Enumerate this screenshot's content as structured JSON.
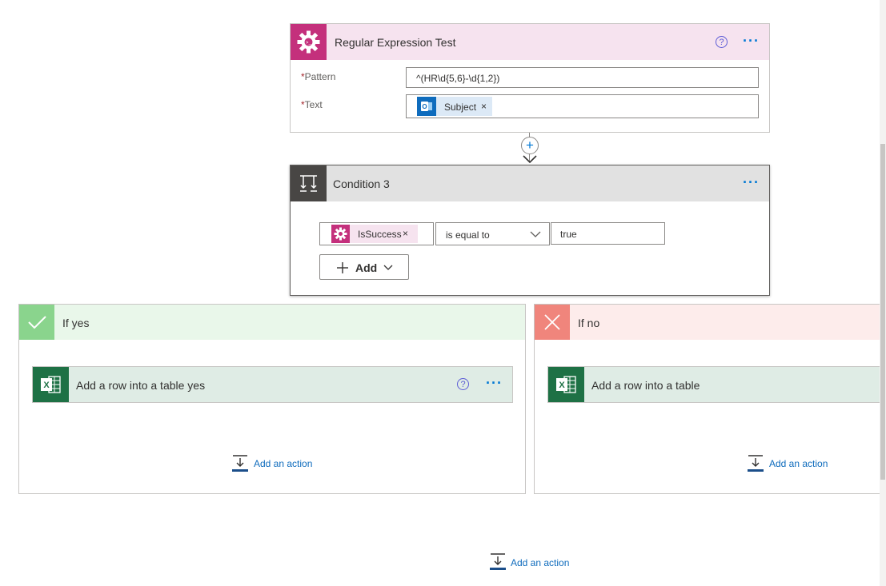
{
  "regex_card": {
    "title": "Regular Expression Test",
    "pattern_label": "Pattern",
    "pattern_value": "^(HR\\d{5,6}-\\d{1,2})",
    "text_label": "Text",
    "text_token": "Subject",
    "required_mark": "*",
    "help_glyph": "?",
    "more_glyph": "···",
    "header_color": "#f6e3ef",
    "icon_color": "#c4307c"
  },
  "connector": {
    "plus_glyph": "+"
  },
  "condition": {
    "title": "Condition 3",
    "more_glyph": "···",
    "left_token": "IsSuccess",
    "operator": "is equal to",
    "right_value": "true",
    "add_label": "Add",
    "header_color": "#e1e1e1",
    "icon_color": "#484644"
  },
  "branch_yes": {
    "title": "If yes",
    "action_title": "Add a row into a table yes",
    "add_action": "Add an action",
    "header_color": "#e9f7ea",
    "icon_color": "#8ad48d"
  },
  "branch_no": {
    "title": "If no",
    "action_title": "Add a row into a table",
    "add_action": "Add an action",
    "header_color": "#fdeceb",
    "icon_color": "#f0857c"
  },
  "excel": {
    "icon_letter": "X",
    "header_color": "#dfece5",
    "icon_color": "#1e7145"
  },
  "bottom": {
    "add_action": "Add an action"
  },
  "token_x": "×"
}
